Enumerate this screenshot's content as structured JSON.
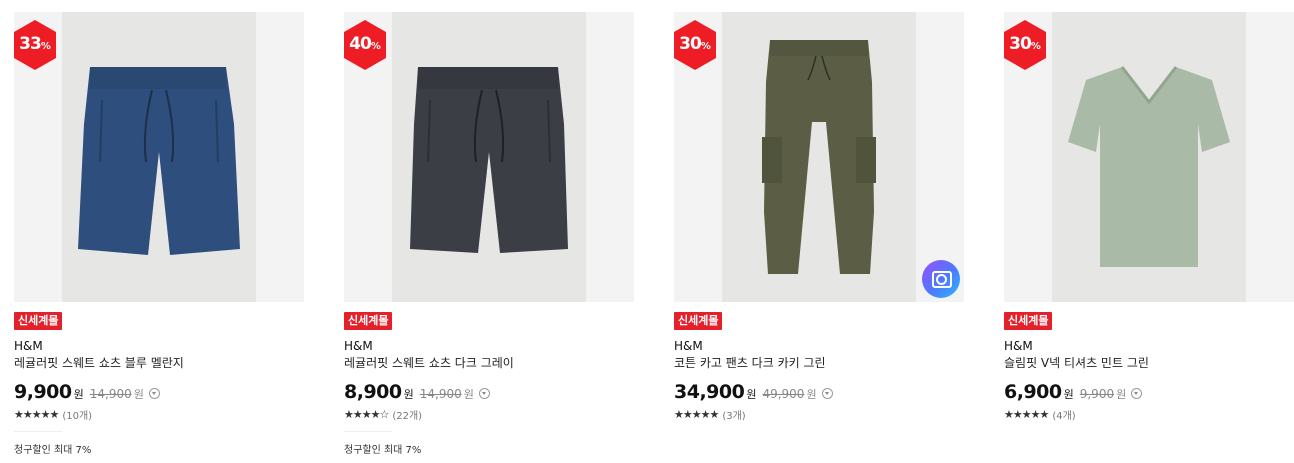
{
  "products": [
    {
      "discount": "33",
      "pct": "%",
      "tag": "신세계몰",
      "brand": "H&M",
      "title": "레귤러핏 스웨트 쇼츠 블루 멜란지",
      "price": "9,900",
      "won": "원",
      "orig": "14,900",
      "orig_won": "원",
      "stars": "★★★★★",
      "reviews": "(10개)",
      "extra": "청구할인 최대 7%",
      "image": "blue-sweat-shorts",
      "color": "#2e4e7e"
    },
    {
      "discount": "40",
      "pct": "%",
      "tag": "신세계몰",
      "brand": "H&M",
      "title": "레귤러핏 스웨트 쇼츠 다크 그레이",
      "price": "8,900",
      "won": "원",
      "orig": "14,900",
      "orig_won": "원",
      "stars": "★★★★☆",
      "reviews": "(22개)",
      "extra": "청구할인 최대 7%",
      "image": "dark-gray-sweat-shorts",
      "color": "#3b3e44"
    },
    {
      "discount": "30",
      "pct": "%",
      "tag": "신세계몰",
      "brand": "H&M",
      "title": "코튼 카고 팬츠 다크 카키 그린",
      "price": "34,900",
      "won": "원",
      "orig": "49,900",
      "orig_won": "원",
      "stars": "★★★★★",
      "reviews": "(3개)",
      "image": "khaki-cargo-pants",
      "color": "#5b5e45"
    },
    {
      "discount": "30",
      "pct": "%",
      "tag": "신세계몰",
      "brand": "H&M",
      "title": "슬림핏 V넥 티셔츠 민트 그린",
      "price": "6,900",
      "won": "원",
      "orig": "9,900",
      "orig_won": "원",
      "stars": "★★★★★",
      "reviews": "(4개)",
      "image": "mint-v-neck-tee",
      "color": "#a9bba6"
    }
  ],
  "colors": {
    "accent": "#e4202b",
    "badge": "#ee1c25"
  }
}
